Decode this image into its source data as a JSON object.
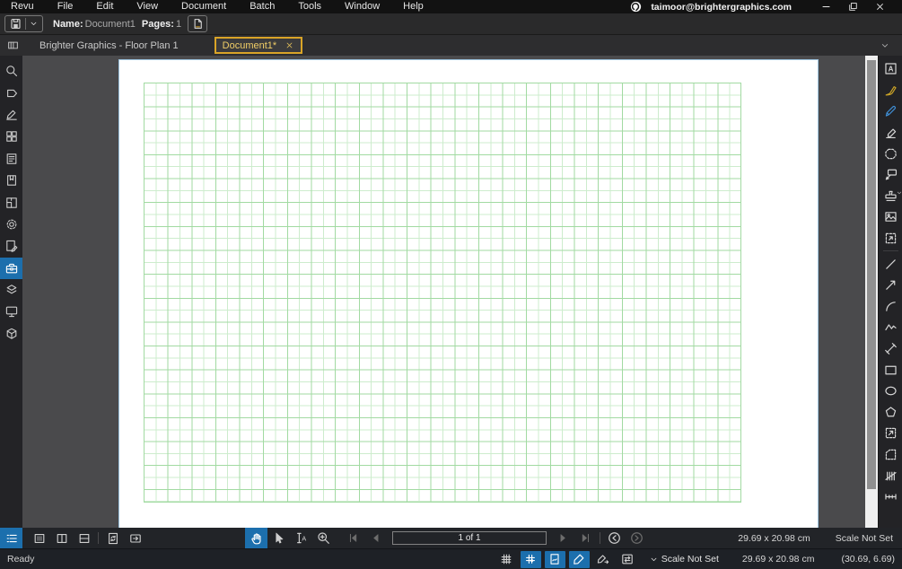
{
  "window": {
    "account_email": "taimoor@brightergraphics.com"
  },
  "menu": {
    "items": [
      "Revu",
      "File",
      "Edit",
      "View",
      "Document",
      "Batch",
      "Tools",
      "Window",
      "Help"
    ]
  },
  "toolbar": {
    "name_label": "Name:",
    "name_value": "Document1",
    "pages_label": "Pages:",
    "pages_value": "1"
  },
  "tabs": {
    "items": [
      {
        "label": "Brighter Graphics - Floor Plan 1",
        "active": false
      },
      {
        "label": "Document1*",
        "active": true
      }
    ]
  },
  "bottom_toolbar": {
    "page_indicator": "1 of 1",
    "page_size": "29.69 x 20.98 cm",
    "scale_status": "Scale Not Set"
  },
  "status_bar": {
    "state": "Ready",
    "scale_status": "Scale Not Set",
    "page_size": "29.69 x 20.98 cm",
    "coordinates": "(30.69, 6.69)"
  },
  "colors": {
    "accent_blue": "#1c6fad",
    "tab_active_border": "#d9a427",
    "grid_minor": "#cdeccd",
    "grid_major": "#a2daa2",
    "canvas_background": "#4a4a4c",
    "pen_gold": "#c9a227",
    "pen_blue": "#3f8fd6"
  },
  "icons": {
    "left_sidebar": [
      "search-icon",
      "file-access-icon",
      "signature-icon",
      "thumbnails-icon",
      "properties-icon",
      "bookmarks-icon",
      "spaces-icon",
      "settings-gear-icon",
      "markup-summary-icon",
      "tool-chest-icon",
      "layers-icon",
      "studio-icon",
      "3d-model-icon"
    ],
    "right_sidebar": [
      "text-box-icon",
      "calligraphy-pen-icon",
      "pen-icon",
      "highlighter-icon",
      "cloud-polygon-icon",
      "callout-icon",
      "stamp-icon",
      "image-icon",
      "snapshot-icon",
      "line-icon",
      "arrow-icon",
      "arc-icon",
      "polyline-icon",
      "length-measure-icon",
      "rectangle-icon",
      "ellipse-icon",
      "polygon-icon",
      "area-measure-icon",
      "perimeter-measure-icon",
      "count-measure-icon",
      "segment-measure-icon"
    ],
    "bottom_toolbar": [
      "markups-list-icon",
      "single-pane-icon",
      "split-vertical-icon",
      "split-horizontal-icon",
      "sync-views-icon",
      "detach-window-icon",
      "pan-hand-icon",
      "select-cursor-icon",
      "select-text-icon",
      "zoom-icon",
      "first-page-icon",
      "previous-page-icon",
      "next-page-icon",
      "last-page-icon",
      "history-back-icon",
      "history-forward-icon"
    ],
    "status_bar": [
      "grid-icon",
      "snap-to-grid-icon",
      "snap-to-content-icon",
      "snap-to-markup-icon",
      "markup-sequence-icon",
      "synchronize-views-icon",
      "chevron-down-icon"
    ]
  }
}
